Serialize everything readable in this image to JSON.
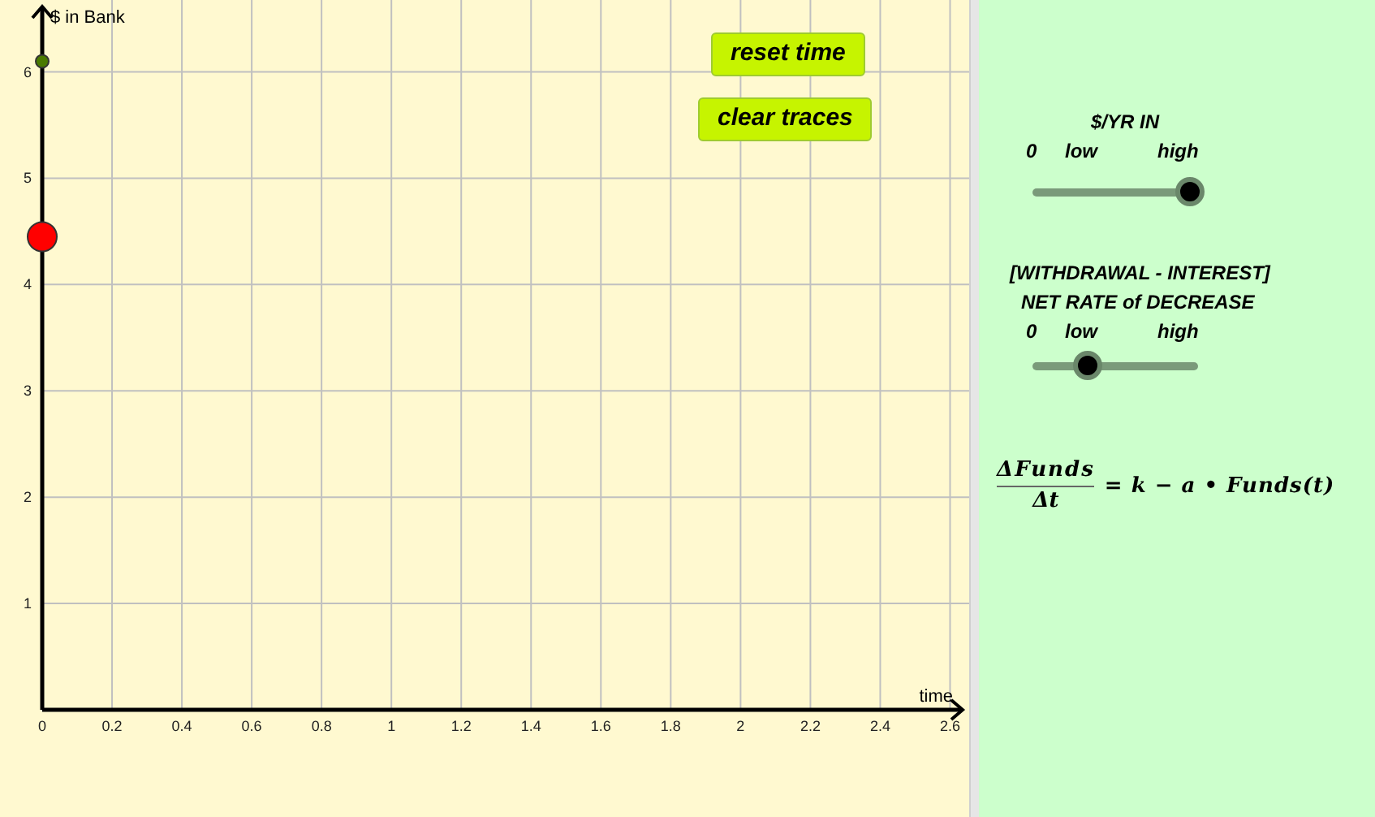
{
  "graph": {
    "buttons": [
      {
        "label": "reset time"
      },
      {
        "label": "clear traces"
      }
    ],
    "chart_data": {
      "type": "scatter",
      "xlabel": "time",
      "ylabel": "$ in Bank",
      "xlim": [
        0,
        2.65
      ],
      "ylim": [
        0,
        6.6
      ],
      "grid": true,
      "xticks": [
        0,
        0.2,
        0.4,
        0.6,
        0.8,
        1,
        1.2,
        1.4,
        1.6,
        1.8,
        2,
        2.2,
        2.4,
        2.6
      ],
      "yticks": [
        1,
        2,
        3,
        4,
        5,
        6
      ],
      "x": [
        0
      ],
      "series": [
        {
          "color": "#ff0000",
          "values": [
            4.45
          ]
        },
        {
          "color": "#4a7a00",
          "values": [
            6.1
          ]
        }
      ]
    }
  },
  "controls": {
    "sliders": [
      {
        "title_lines": [
          "$/YR IN"
        ],
        "zero": "0",
        "low": "low",
        "high": "high",
        "level": 1
      },
      {
        "title_lines": [
          "[WITHDRAWAL - INTEREST]",
          "NET RATE of DECREASE"
        ],
        "zero": "0",
        "low": "low",
        "high": "high",
        "level": 0.31
      }
    ],
    "equation": {
      "numerator": "ΔFunds",
      "denominator": "Δt",
      "rhs": "= k − a • Funds(t)"
    }
  }
}
